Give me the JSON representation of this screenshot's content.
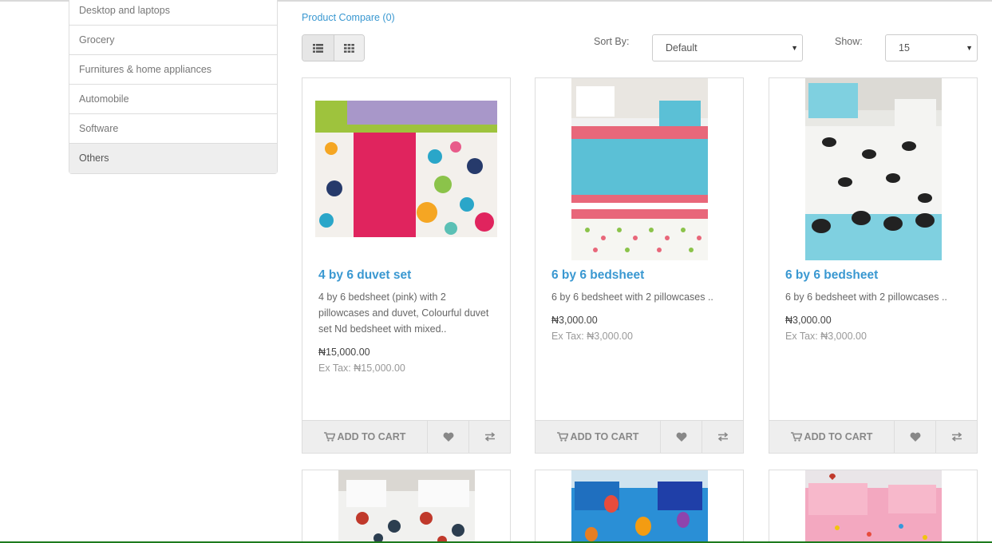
{
  "sidebar": {
    "items": [
      {
        "label": "Desktop and laptops"
      },
      {
        "label": "Grocery"
      },
      {
        "label": "Furnitures & home appliances"
      },
      {
        "label": "Automobile"
      },
      {
        "label": "Software"
      },
      {
        "label": "Others",
        "active": true
      }
    ]
  },
  "toolbar": {
    "compare_link": "Product Compare (0)",
    "sort_label": "Sort By:",
    "sort_value": "Default",
    "show_label": "Show:",
    "show_value": "15"
  },
  "products": [
    {
      "name": "4 by 6 duvet set",
      "description": "4 by 6 bedsheet (pink) with 2 pillowcases and duvet, Colourful duvet set Nd bedsheet with mixed..",
      "price": "₦15,000.00",
      "ex_tax": "Ex Tax: ₦15,000.00"
    },
    {
      "name": "6 by 6 bedsheet",
      "description": "6 by 6 bedsheet with 2 pillowcases ..",
      "price": "₦3,000.00",
      "ex_tax": "Ex Tax: ₦3,000.00"
    },
    {
      "name": "6 by 6 bedsheet",
      "description": "6 by 6 bedsheet with 2 pillowcases ..",
      "price": "₦3,000.00",
      "ex_tax": "Ex Tax: ₦3,000.00"
    }
  ],
  "buttons": {
    "add_to_cart": "ADD TO CART"
  },
  "icons": {
    "list_view": "list-icon",
    "grid_view": "grid-icon",
    "cart": "shopping-cart-icon",
    "wishlist": "heart-icon",
    "compare": "exchange-icon",
    "dropdown": "caret-down-icon"
  },
  "colors": {
    "link": "#3a98d1",
    "active_item_bg": "#eeeeee",
    "button_bg": "#eeeeee"
  }
}
